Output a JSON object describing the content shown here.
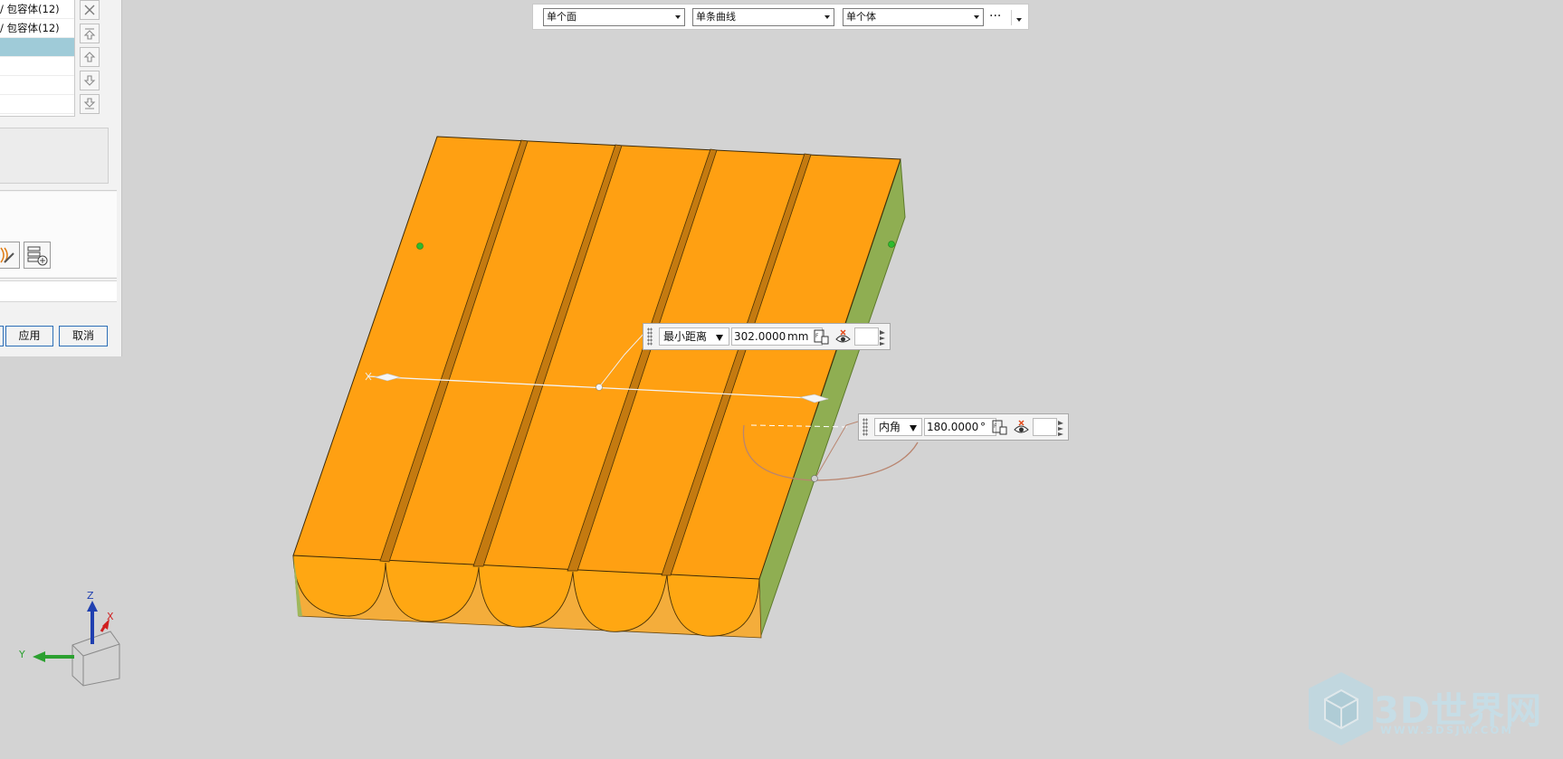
{
  "dialog": {
    "list_items": [
      {
        "label": "/ 包容体(12)",
        "selected": false
      },
      {
        "label": "/ 包容体(12)",
        "selected": false
      },
      {
        "label": "",
        "selected": true
      },
      {
        "label": "",
        "selected": false
      },
      {
        "label": "",
        "selected": false
      },
      {
        "label": "",
        "selected": false
      }
    ],
    "side_buttons": [
      "close-icon",
      "move-to-top-icon",
      "move-up-icon",
      "move-down-icon",
      "move-to-bottom-icon"
    ],
    "tool_icons": [
      "measure-brush-icon",
      "add-list-icon"
    ],
    "apply_label": "应用",
    "cancel_label": "取消"
  },
  "selection_bar": {
    "face_filter": "单个面",
    "curve_filter": "单条曲线",
    "body_filter": "单个体",
    "more_label": "···"
  },
  "measure_distance": {
    "mode": "最小距离",
    "value": "302.0000",
    "unit": "mm"
  },
  "measure_angle": {
    "mode": "内角",
    "value": "180.0000",
    "unit": "°"
  },
  "triad": {
    "z_label": "Z",
    "x_label": "X",
    "y_label": "Y"
  },
  "watermark": {
    "title": "3D世界网",
    "subtitle": "WWW.3DSJW.COM"
  },
  "colors": {
    "background": "#d3d3d3",
    "part_orange": "#ffa012",
    "part_groove": "#c97a0c",
    "part_side_green": "#8bab4e",
    "selection_blue": "#9fcbd8"
  }
}
